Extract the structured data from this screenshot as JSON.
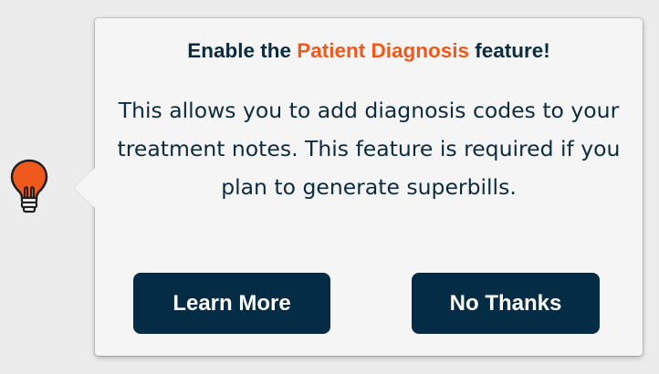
{
  "popover": {
    "title_prefix": "Enable the ",
    "title_highlight": "Patient Diagnosis",
    "title_suffix": " feature!",
    "body": "This allows you to add diagnosis codes to your treatment notes. This feature is required if you plan to generate superbills.",
    "learn_more_label": "Learn More",
    "no_thanks_label": "No Thanks"
  },
  "icon": {
    "name": "lightbulb-icon",
    "color": "#ef5a1c"
  },
  "colors": {
    "accent": "#ef5a1c",
    "text": "#0d2b3e",
    "button_bg": "#042c44",
    "popover_bg": "#f5f5f5",
    "page_bg": "#ececec"
  }
}
